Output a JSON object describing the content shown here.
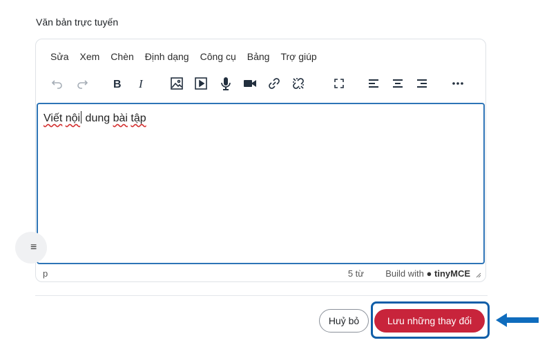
{
  "field": {
    "label": "Văn bản trực tuyến"
  },
  "menubar": [
    "Sửa",
    "Xem",
    "Chèn",
    "Định dạng",
    "Công cụ",
    "Bảng",
    "Trợ giúp"
  ],
  "toolbar": {
    "icons": [
      "undo-icon",
      "redo-icon",
      "bold-icon",
      "italic-icon",
      "image-icon",
      "media-icon",
      "microphone-icon",
      "video-icon",
      "link-icon",
      "unlink-icon",
      "fullscreen-icon",
      "align-left-icon",
      "align-center-icon",
      "align-right-icon",
      "more-icon"
    ]
  },
  "content": {
    "word1": "Viết",
    "word2a": "nội",
    "word3": " dung ",
    "word4": "bài",
    "word5": " ",
    "word6": "tập"
  },
  "status": {
    "path": "p",
    "words": "5 từ",
    "build_with": "Build with",
    "brand": "tinyMCE"
  },
  "buttons": {
    "cancel": "Huỷ bỏ",
    "save": "Lưu những thay đổi"
  },
  "colors": {
    "accent": "#2d74b6",
    "save_button": "#c8243b",
    "focus_frame": "#0f5ea8",
    "arrow": "#0f6cbd"
  }
}
